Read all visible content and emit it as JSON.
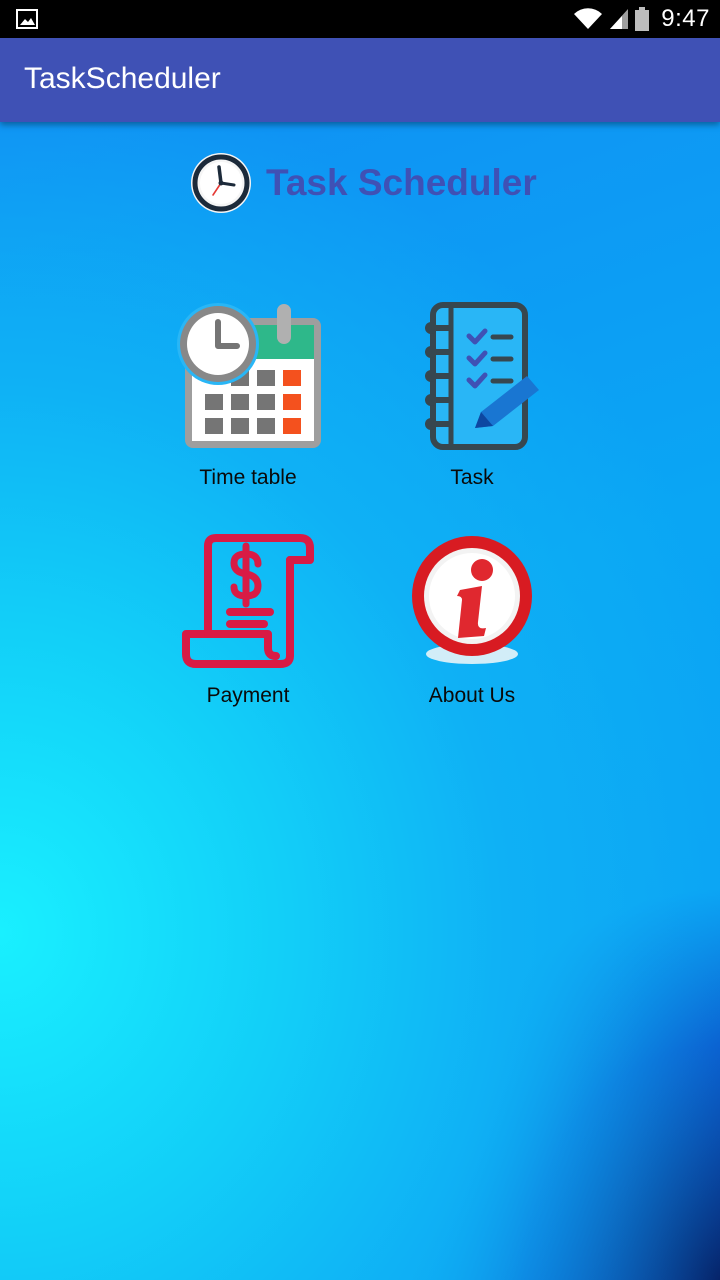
{
  "status_bar": {
    "time": "9:47",
    "icons": [
      "gallery-notification-icon",
      "wifi-icon",
      "signal-icon",
      "battery-icon"
    ]
  },
  "app_bar": {
    "title": "TaskScheduler"
  },
  "header": {
    "title": "Task Scheduler",
    "logo": "clock-icon"
  },
  "menu": {
    "timetable": {
      "label": "Time table",
      "icon": "calendar-clock-icon"
    },
    "task": {
      "label": "Task",
      "icon": "checklist-notebook-icon"
    },
    "payment": {
      "label": "Payment",
      "icon": "receipt-dollar-icon"
    },
    "about": {
      "label": "About Us",
      "icon": "info-icon"
    }
  },
  "colors": {
    "app_bar": "#3f51b5",
    "header_title": "#3f51b5",
    "background_light": "#19f0ff",
    "background_dark": "#0a4ec8"
  }
}
